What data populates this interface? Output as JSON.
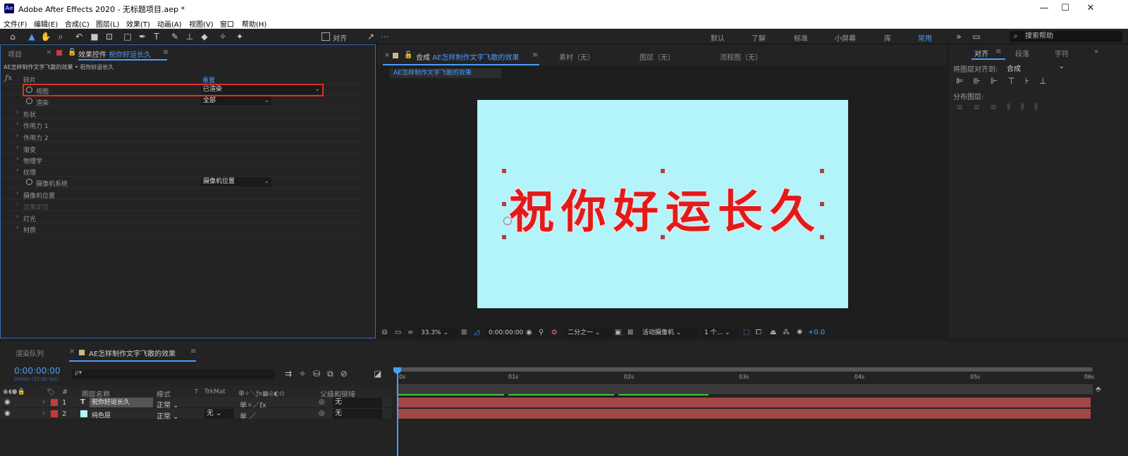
{
  "app": {
    "logo": "Ae",
    "window_title": "Adobe After Effects 2020 - 无标题项目.aep *"
  },
  "menu": [
    "文件(F)",
    "编辑(E)",
    "合成(C)",
    "图层(L)",
    "效果(T)",
    "动画(A)",
    "视图(V)",
    "窗口",
    "帮助(H)"
  ],
  "toolbar": {
    "align_label": "对齐",
    "workspaces": [
      "默认",
      "了解",
      "标准",
      "小屏幕",
      "库",
      "常用"
    ],
    "active_workspace": "常用",
    "search_placeholder": "搜索帮助"
  },
  "left_panel": {
    "tab_project": "项目",
    "tab_effects_prefix": "效果控件",
    "tab_effects_layer": "祝你好运长久",
    "breadcrumb": "AE怎样制作文字飞散的效果 • 祝你好运长久",
    "fx_name": "碎片",
    "reset": "重置",
    "rows": [
      {
        "label": "视图",
        "value": "已渲染",
        "stopwatch": true
      },
      {
        "label": "渲染",
        "value": "全部",
        "stopwatch": true
      },
      {
        "label": "形状"
      },
      {
        "label": "作用力 1"
      },
      {
        "label": "作用力 2"
      },
      {
        "label": "渐变"
      },
      {
        "label": "物理学"
      },
      {
        "label": "纹理"
      },
      {
        "label": "摄像机系统",
        "value": "摄像机位置",
        "stopwatch": true
      },
      {
        "label": "摄像机位置"
      },
      {
        "label": "边角定位"
      },
      {
        "label": "灯光"
      },
      {
        "label": "材质"
      }
    ]
  },
  "comp_panel": {
    "tab_comp_prefix": "合成",
    "tab_comp_name": "AE怎样制作文字飞散的效果",
    "tab_footage": "素材（无）",
    "tab_layer": "图层（无）",
    "tab_flow": "流程图（无）",
    "comp_chip": "AE怎样制作文字飞散的效果",
    "text_chars": [
      "祝",
      "你",
      "好",
      "运",
      "长",
      "久"
    ],
    "canvas_color": "#b2f4fa",
    "text_color": "#e01b1b",
    "zoom": "33.3%",
    "timecode": "0:00:00:00",
    "resolution": "二分之一",
    "camera": "活动摄像机",
    "views": "1 个...",
    "exposure": "+0.0"
  },
  "right_panel": {
    "tab_align": "对齐",
    "tab_paragraph": "段落",
    "tab_character": "字符",
    "align_to_label": "将图层对齐到:",
    "align_to_value": "合成",
    "distribute_label": "分布图层:"
  },
  "timeline": {
    "tab_render": "渲染队列",
    "tab_comp": "AE怎样制作文字飞散的效果",
    "timecode": "0:00:00:00",
    "frame_info": "00000 (25.00 fps)",
    "search_placeholder": "ρ▾",
    "headers": {
      "num": "#",
      "name": "图层名称",
      "mode": "模式",
      "t": "T",
      "trkmat": "TrkMat",
      "parent": "父级和链接"
    },
    "ruler": [
      "0s",
      "01s",
      "02s",
      "03s",
      "04s",
      "05s",
      "06s"
    ],
    "layers": [
      {
        "num": "1",
        "type": "T",
        "name": "祝你好运长久",
        "mode": "正常",
        "trkmat": "",
        "parent": "无",
        "color": "#c83a3a"
      },
      {
        "num": "2",
        "type": "",
        "name": "纯色层",
        "mode": "正常",
        "trkmat": "无",
        "parent": "无",
        "color": "#c83a3a",
        "swatch": "#b2f4fa"
      }
    ]
  }
}
